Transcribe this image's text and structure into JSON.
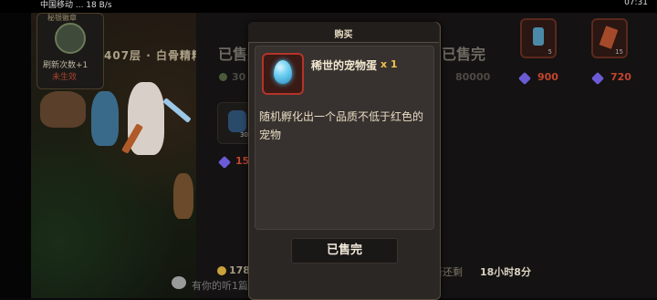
{
  "status_bar": {
    "left": "中国移动 ... 18 B/s",
    "right": "07:31"
  },
  "scene": {
    "tower_title": "秘银徽章",
    "refresh_label": "刷新次数+1",
    "refresh_status": "未生效",
    "floor_label": "407层 · 白骨精精"
  },
  "shop": {
    "sold_1": "已售完",
    "sold_2": "已售完",
    "price_1": "30",
    "price_2": "80000",
    "price_3": "900",
    "price_4": "720",
    "price_5": "15",
    "slot_qty_1": "5",
    "slot_qty_2": "15",
    "slot_qty_3": "30",
    "reset_text": "新还剩",
    "timer": "18小时8分",
    "coins": "1780",
    "chat_text": "有你的听1篇不旦的 ...",
    "colors": {
      "gem": "#6b5bd6",
      "price_red": "#c2452e",
      "coin": "#c8a23a"
    }
  },
  "modal": {
    "title": "购买",
    "item_name": "稀世的宠物蛋",
    "item_qty": "x 1",
    "item_desc": "随机孵化出一个品质不低于红色的宠物",
    "button_label": "已售完",
    "item_icon": "pet-egg-icon",
    "colors": {
      "frame": "#b4342a",
      "qty": "#f1c24a",
      "egg": "#48c3f0"
    }
  }
}
